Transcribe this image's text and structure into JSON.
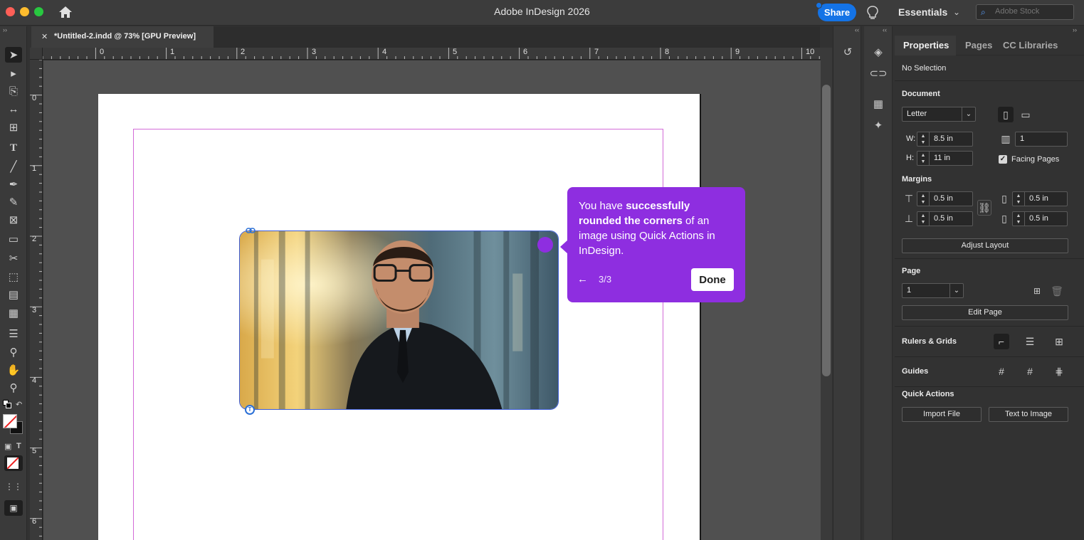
{
  "window": {
    "title": "Adobe InDesign 2026"
  },
  "titlebar": {
    "share_label": "Share",
    "workspace_label": "Essentials",
    "stock_placeholder": "Adobe Stock"
  },
  "document_tab": {
    "name": "*Untitled-2.indd @ 73% [GPU Preview]"
  },
  "rulers": {
    "horizontal": [
      "0",
      "1",
      "2",
      "3",
      "4",
      "5",
      "6",
      "7",
      "8",
      "9",
      "10"
    ],
    "vertical": [
      "0",
      "1",
      "2",
      "3",
      "4",
      "5",
      "6"
    ]
  },
  "coachmark": {
    "text_pre": "You have ",
    "text_bold": "successfully rounded the corners",
    "text_post": " of an image using Quick Actions in InDesign.",
    "step": "3/3",
    "done_label": "Done"
  },
  "properties": {
    "tabs": [
      "Properties",
      "Pages",
      "CC Libraries"
    ],
    "selection": "No Selection",
    "document": {
      "section_label": "Document",
      "preset": "Letter",
      "width_label": "W:",
      "width": "8.5 in",
      "height_label": "H:",
      "height": "11 in",
      "pages": "1",
      "facing_pages_label": "Facing Pages",
      "facing_pages_checked": true
    },
    "margins": {
      "section_label": "Margins",
      "top": "0.5 in",
      "bottom": "0.5 in",
      "left": "0.5 in",
      "right": "0.5 in",
      "adjust_layout_label": "Adjust Layout"
    },
    "page": {
      "section_label": "Page",
      "current": "1",
      "edit_page_label": "Edit Page"
    },
    "rulers_grids_label": "Rulers & Grids",
    "guides_label": "Guides",
    "quick_actions": {
      "section_label": "Quick Actions",
      "import_file_label": "Import File",
      "text_to_image_label": "Text to Image"
    }
  },
  "colors": {
    "accent_purple": "#8e2ee0",
    "share_blue": "#1473e6",
    "margin_guide": "#d36bd8",
    "frame_selection": "#3b5bd6"
  }
}
